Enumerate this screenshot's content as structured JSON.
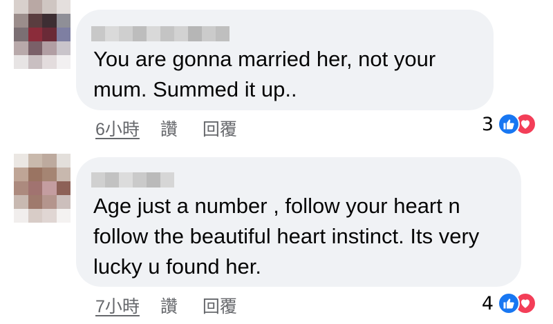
{
  "comments": [
    {
      "text": "You are gonna married her, not your mum. Summed it up..",
      "time": "6小時",
      "like_label": "讚",
      "reply_label": "回覆",
      "reaction_count": "3"
    },
    {
      "text": "Age just a number , follow your heart n follow the beautiful heart instinct. Its very lucky u found her.",
      "time": "7小時",
      "like_label": "讚",
      "reply_label": "回覆",
      "reaction_count": "4"
    }
  ],
  "colors": {
    "bubble": "#f0f2f5",
    "meta_text": "#65676b",
    "like_blue": "#1877f2",
    "love_red": "#f33e58"
  },
  "icons": [
    "like-icon",
    "love-icon"
  ]
}
